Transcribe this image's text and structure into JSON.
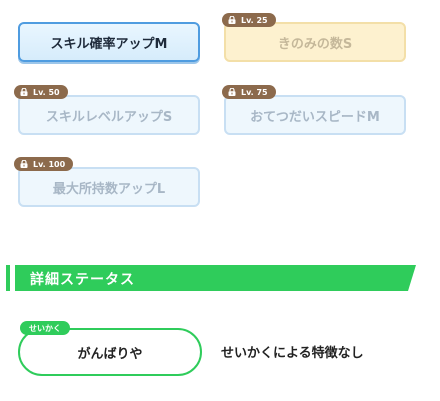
{
  "skills": [
    {
      "label": "スキル確率アップM",
      "level": "",
      "state": "active"
    },
    {
      "label": "きのみの数S",
      "level": "Lv. 25",
      "state": "locked"
    },
    {
      "label": "スキルレベルアップS",
      "level": "Lv. 50",
      "state": "locked"
    },
    {
      "label": "おてつだいスピードM",
      "level": "Lv. 75",
      "state": "locked"
    },
    {
      "label": "最大所持数アップL",
      "level": "Lv. 100",
      "state": "locked"
    }
  ],
  "section": {
    "title": "詳細ステータス"
  },
  "nature": {
    "tag": "せいかく",
    "value": "がんばりや",
    "effect": "せいかくによる特徴なし"
  },
  "colors": {
    "accent_green": "#2fcc5b",
    "active_border": "#4f9ce0",
    "level_badge": "#8c6a4c",
    "gold_fill": "#fdf1cf"
  }
}
